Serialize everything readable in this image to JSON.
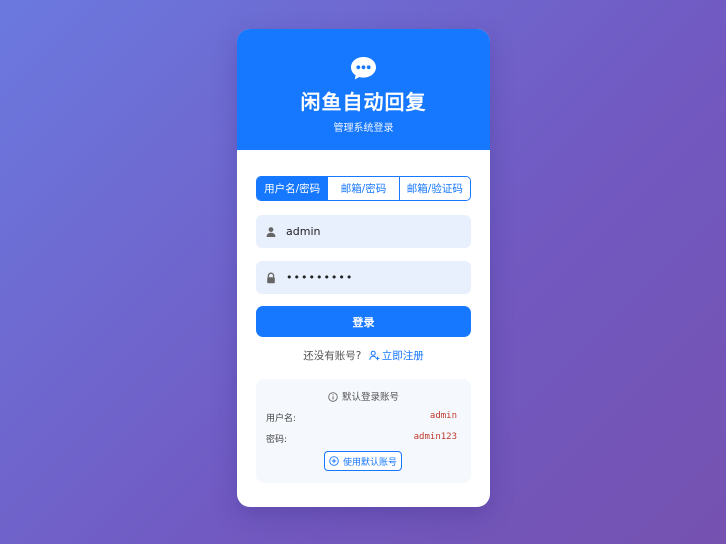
{
  "app": {
    "title": "闲鱼自动回复",
    "subtitle": "管理系统登录",
    "brand_color": "#1677ff",
    "logo_icon": "chat-bubble-icon"
  },
  "tabs": [
    {
      "label": "用户名/密码",
      "active": true
    },
    {
      "label": "邮箱/密码",
      "active": false
    },
    {
      "label": "邮箱/验证码",
      "active": false
    }
  ],
  "form": {
    "username_value": "admin",
    "username_icon": "user-icon",
    "password_value": "•••••••••",
    "password_icon": "lock-icon",
    "login_label": "登录"
  },
  "register": {
    "prompt": "还没有账号?",
    "link_label": "立即注册",
    "link_icon": "add-user-icon"
  },
  "default_account": {
    "title": "默认登录账号",
    "title_icon": "info-icon",
    "username_label": "用户名:",
    "username_value": "admin",
    "password_label": "密码:",
    "password_value": "admin123",
    "value_color": "#c0392b",
    "use_button_label": "使用默认账号",
    "use_button_icon": "plus-circle-icon"
  }
}
